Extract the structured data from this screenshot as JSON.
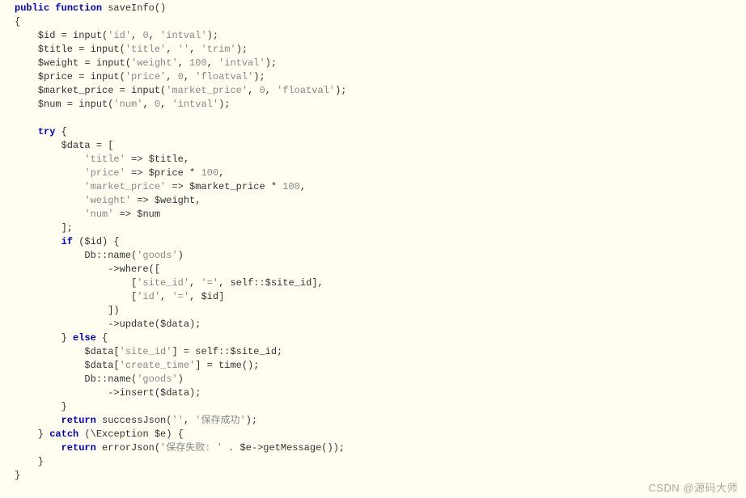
{
  "code": {
    "l1a": "public",
    "l1b": "function",
    "l1c": " saveInfo()",
    "l2": "{",
    "l3a": "    $id = input(",
    "l3b": "'id'",
    "l3c": ", ",
    "l3d": "0",
    "l3e": ", ",
    "l3f": "'intval'",
    "l3g": ");",
    "l4a": "    $title = input(",
    "l4b": "'title'",
    "l4c": ", ",
    "l4d": "''",
    "l4e": ", ",
    "l4f": "'trim'",
    "l4g": ");",
    "l5a": "    $weight = input(",
    "l5b": "'weight'",
    "l5c": ", ",
    "l5d": "100",
    "l5e": ", ",
    "l5f": "'intval'",
    "l5g": ");",
    "l6a": "    $price = input(",
    "l6b": "'price'",
    "l6c": ", ",
    "l6d": "0",
    "l6e": ", ",
    "l6f": "'floatval'",
    "l6g": ");",
    "l7a": "    $market_price = input(",
    "l7b": "'market_price'",
    "l7c": ", ",
    "l7d": "0",
    "l7e": ", ",
    "l7f": "'floatval'",
    "l7g": ");",
    "l8a": "    $num = input(",
    "l8b": "'num'",
    "l8c": ", ",
    "l8d": "0",
    "l8e": ", ",
    "l8f": "'intval'",
    "l8g": ");",
    "l9": "",
    "l10a": "    ",
    "l10b": "try",
    "l10c": " {",
    "l11": "        $data = [",
    "l12a": "            ",
    "l12b": "'title'",
    "l12c": " => $title,",
    "l13a": "            ",
    "l13b": "'price'",
    "l13c": " => $price * ",
    "l13d": "100",
    "l13e": ",",
    "l14a": "            ",
    "l14b": "'market_price'",
    "l14c": " => $market_price * ",
    "l14d": "100",
    "l14e": ",",
    "l15a": "            ",
    "l15b": "'weight'",
    "l15c": " => $weight,",
    "l16a": "            ",
    "l16b": "'num'",
    "l16c": " => $num",
    "l17": "        ];",
    "l18a": "        ",
    "l18b": "if",
    "l18c": " ($id) {",
    "l19a": "            Db::name(",
    "l19b": "'goods'",
    "l19c": ")",
    "l20": "                ->where([",
    "l21a": "                    [",
    "l21b": "'site_id'",
    "l21c": ", ",
    "l21d": "'='",
    "l21e": ", self::$site_id],",
    "l22a": "                    [",
    "l22b": "'id'",
    "l22c": ", ",
    "l22d": "'='",
    "l22e": ", $id]",
    "l23": "                ])",
    "l24": "                ->update($data);",
    "l25a": "        } ",
    "l25b": "else",
    "l25c": " {",
    "l26a": "            $data[",
    "l26b": "'site_id'",
    "l26c": "] = self::$site_id;",
    "l27a": "            $data[",
    "l27b": "'create_time'",
    "l27c": "] = time();",
    "l28a": "            Db::name(",
    "l28b": "'goods'",
    "l28c": ")",
    "l29": "                ->insert($data);",
    "l30": "        }",
    "l31a": "        ",
    "l31b": "return",
    "l31c": " successJson(",
    "l31d": "''",
    "l31e": ", ",
    "l31f": "'保存成功'",
    "l31g": ");",
    "l32a": "    } ",
    "l32b": "catch",
    "l32c": " (\\Exception $e) {",
    "l33a": "        ",
    "l33b": "return",
    "l33c": " errorJson(",
    "l33d": "'保存失败: '",
    "l33e": " . $e->getMessage());",
    "l34": "    }",
    "l35": "}"
  },
  "watermark": "CSDN @源码大师"
}
